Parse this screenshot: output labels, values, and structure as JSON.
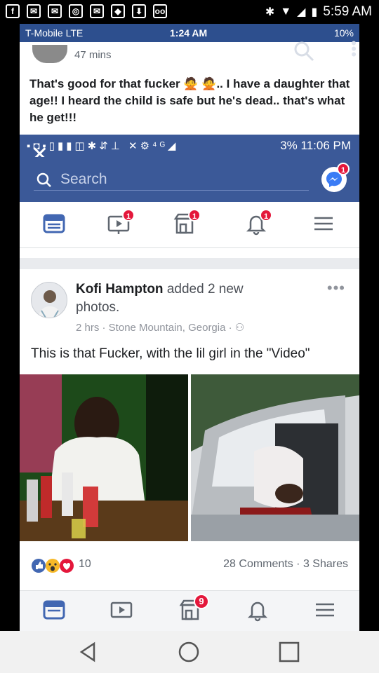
{
  "outer_status": {
    "left_icons": [
      "f",
      "✉",
      "✉",
      "◎",
      "✉",
      "◆",
      "⬇",
      "oo"
    ],
    "time": "5:59 AM"
  },
  "inner_status_top": {
    "carrier": "T-Mobile  LTE",
    "time": "1:24 AM",
    "battery": "10%"
  },
  "old_post": {
    "time": "47 mins",
    "text": "That's good for that fucker 🙅 🙅.. I have a daughter that age!! I heard the child is safe but he's dead.. that's what he get!!!"
  },
  "inner_status_bottom": {
    "right": "3%  11:06 PM"
  },
  "search": {
    "placeholder": "Search",
    "messenger_badge": "1"
  },
  "nav": {
    "badges": {
      "video": "1",
      "marketplace": "1",
      "notifications": "1"
    }
  },
  "post": {
    "author": "Kofi Hampton",
    "action": " added 2 new photos.",
    "meta": "2 hrs · Stone Mountain, Georgia ·",
    "text": "This is that Fucker, with the lil girl in the \"Video\"",
    "reactions_count": "10",
    "comments_shares": "28 Comments · 3 Shares"
  },
  "bottom_nav": {
    "marketplace_badge": "9"
  },
  "colors": {
    "facebook_blue": "#3b5998",
    "badge_red": "#e4173b"
  }
}
